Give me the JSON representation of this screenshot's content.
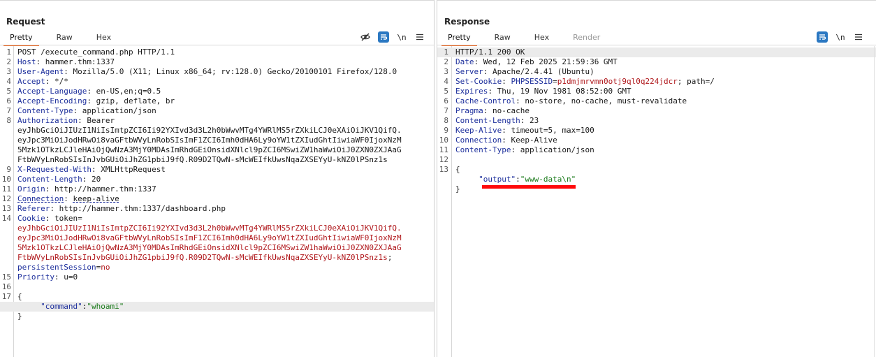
{
  "request": {
    "title": "Request",
    "tabs": [
      {
        "label": "Pretty",
        "active": true
      },
      {
        "label": "Raw",
        "active": false
      },
      {
        "label": "Hex",
        "active": false
      }
    ],
    "newline_label": "\\n",
    "icons": [
      "hide-icon",
      "wrap-icon",
      "newline-icon",
      "menu-icon"
    ],
    "lines": [
      {
        "n": "1",
        "text": "POST /execute_command.php HTTP/1.1"
      },
      {
        "n": "2",
        "key": "Host",
        "val": "hammer.thm:1337"
      },
      {
        "n": "3",
        "key": "User-Agent",
        "val": "Mozilla/5.0 (X11; Linux x86_64; rv:128.0) Gecko/20100101 Firefox/128.0"
      },
      {
        "n": "4",
        "key": "Accept",
        "val": "*/*"
      },
      {
        "n": "5",
        "key": "Accept-Language",
        "val": "en-US,en;q=0.5"
      },
      {
        "n": "6",
        "key": "Accept-Encoding",
        "val": "gzip, deflate, br"
      },
      {
        "n": "7",
        "key": "Content-Type",
        "val": "application/json"
      },
      {
        "n": "8",
        "key": "Authorization",
        "val": "Bearer"
      },
      {
        "n": "",
        "text": "eyJhbGciOiJIUzI1NiIsImtpZCI6Ii92YXIvd3d3L2h0bWwvMTg4YWRlMS5rZXkiLCJ0eXAiOiJKV1QifQ."
      },
      {
        "n": "",
        "text": "eyJpc3MiOiJodHRwOi8vaGFtbWVyLnRobSIsImF1ZCI6Imh0dHA6Ly9oYW1tZXIudGhtIiwiaWF0IjoxNzM"
      },
      {
        "n": "",
        "text": "5Mzk1OTkzLCJleHAiOjQwNzA3MjY0MDAsImRhdGEiOnsidXNlcl9pZCI6MSwiZW1haWwiOiJ0ZXN0ZXJAaG"
      },
      {
        "n": "",
        "text": "FtbWVyLnRobSIsInJvbGUiOiJhZG1pbiJ9fQ.R09D2TQwN-sMcWEIfkUwsNqaZXSEYyU-kNZ0lPSnz1s"
      },
      {
        "n": "9",
        "key": "X-Requested-With",
        "val": "XMLHttpRequest"
      },
      {
        "n": "10",
        "key": "Content-Length",
        "val": "20"
      },
      {
        "n": "11",
        "key": "Origin",
        "val": "http://hammer.thm:1337"
      },
      {
        "n": "12",
        "key": "Connection",
        "val": "keep-alive",
        "dashed": true
      },
      {
        "n": "13",
        "key": "Referer",
        "val": "http://hammer.thm:1337/dashboard.php"
      },
      {
        "n": "14",
        "key": "Cookie",
        "val": "token="
      },
      {
        "n": "",
        "red": "eyJhbGciOiJIUzI1NiIsImtpZCI6Ii92YXIvd3d3L2h0bWwvMTg4YWRlMS5rZXkiLCJ0eXAiOiJKV1QifQ."
      },
      {
        "n": "",
        "red": "eyJpc3MiOiJodHRwOi8vaGFtbWVyLnRobSIsImF1ZCI6Imh0dHA6Ly9oYW1tZXIudGhtIiwiaWF0IjoxNzM"
      },
      {
        "n": "",
        "red": "5Mzk1OTkzLCJleHAiOjQwNzA3MjY0MDAsImRhdGEiOnsidXNlcl9pZCI6MSwiZW1haWwiOiJ0ZXN0ZXJAaG"
      },
      {
        "n": "",
        "red": "FtbWVyLnRobSIsInJvbGUiOiJhZG1pbiJ9fQ.R09D2TQwN-sMcWEIfkUwsNqaZXSEYyU-kNZ0lPSnz1s",
        "tail": ";"
      },
      {
        "n": "",
        "ckey": "persistentSession",
        "cval": "no"
      },
      {
        "n": "15",
        "key": "Priority",
        "val": "u=0"
      },
      {
        "n": "16",
        "text": ""
      },
      {
        "n": "17",
        "text": "{"
      },
      {
        "n": "",
        "jkey": "\"command\"",
        "jval": "\"whoami\"",
        "hl": true
      },
      {
        "n": "",
        "text": "}"
      }
    ]
  },
  "response": {
    "title": "Response",
    "tabs": [
      {
        "label": "Pretty",
        "active": true
      },
      {
        "label": "Raw",
        "active": false
      },
      {
        "label": "Hex",
        "active": false
      },
      {
        "label": "Render",
        "active": false,
        "disabled": true
      }
    ],
    "newline_label": "\\n",
    "lines": [
      {
        "n": "1",
        "text": "HTTP/1.1 200 OK",
        "hl": true
      },
      {
        "n": "2",
        "key": "Date",
        "val": "Wed, 12 Feb 2025 21:59:36 GMT"
      },
      {
        "n": "3",
        "key": "Server",
        "val": "Apache/2.4.41 (Ubuntu)"
      },
      {
        "n": "4",
        "key": "Set-Cookie",
        "ckey": "PHPSESSID",
        "cred": "p1dmjmrvmn0otj9ql0q224jdcr",
        "ctail": "; path=/"
      },
      {
        "n": "5",
        "key": "Expires",
        "val": "Thu, 19 Nov 1981 08:52:00 GMT"
      },
      {
        "n": "6",
        "key": "Cache-Control",
        "val": "no-store, no-cache, must-revalidate"
      },
      {
        "n": "7",
        "key": "Pragma",
        "val": "no-cache"
      },
      {
        "n": "8",
        "key": "Content-Length",
        "val": "23"
      },
      {
        "n": "9",
        "key": "Keep-Alive",
        "val": "timeout=5, max=100"
      },
      {
        "n": "10",
        "key": "Connection",
        "val": "Keep-Alive"
      },
      {
        "n": "11",
        "key": "Content-Type",
        "val": "application/json"
      },
      {
        "n": "12",
        "text": ""
      },
      {
        "n": "13",
        "text": "{"
      },
      {
        "n": "",
        "jkey": "\"output\"",
        "jval": "\"www-data\\n\""
      },
      {
        "n": "",
        "text": "}"
      }
    ]
  },
  "colors": {
    "accent": "#e85b10",
    "button_blue": "#2b78c2",
    "header_key": "#1d2f9c",
    "cookie_value": "#b0181c",
    "json_string": "#1a7a1a",
    "annotation": "#ff0a0a"
  }
}
